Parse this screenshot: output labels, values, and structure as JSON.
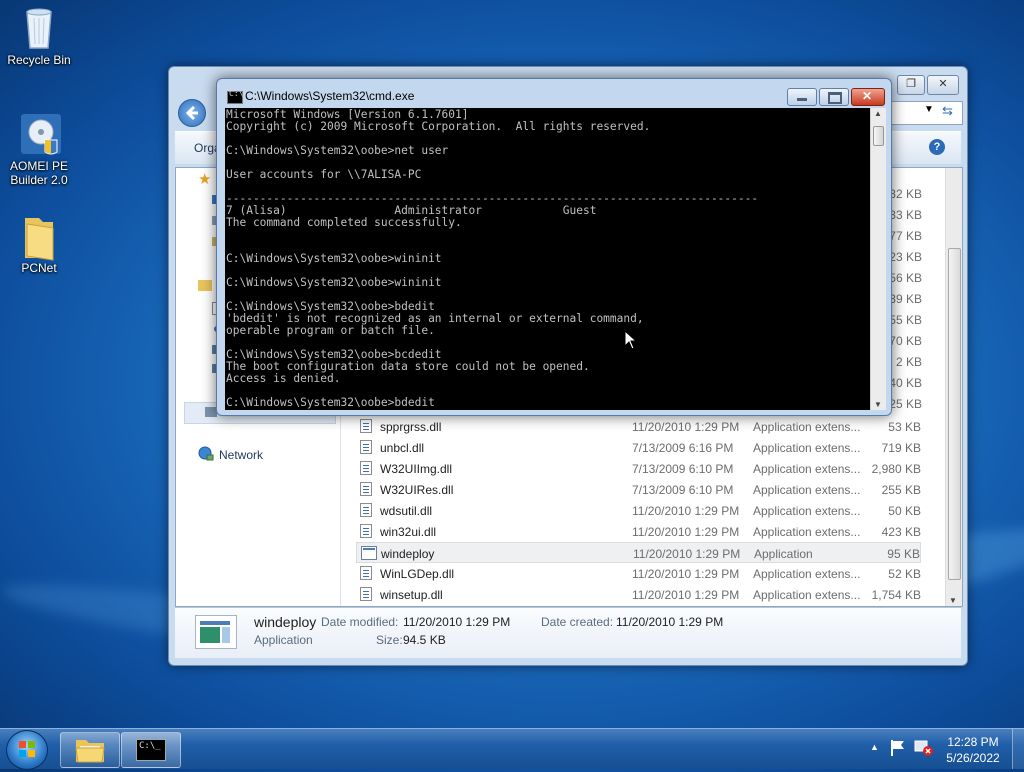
{
  "desktop": {
    "icons": [
      {
        "label": "Recycle Bin",
        "icon": "recycle-bin-icon"
      },
      {
        "label": "AOMEI PE Builder 2.0",
        "icon": "aomei-pe-builder-icon"
      },
      {
        "label": "PCNet",
        "icon": "folder-icon"
      }
    ]
  },
  "explorer": {
    "toolbar_organize": "Orga",
    "nav_network": "Network",
    "files": [
      {
        "name": "spprgrss.dll",
        "date": "11/20/2010 1:29 PM",
        "type": "Application extens...",
        "size": "53 KB"
      },
      {
        "name": "unbcl.dll",
        "date": "7/13/2009 6:16 PM",
        "type": "Application extens...",
        "size": "719 KB"
      },
      {
        "name": "W32UIImg.dll",
        "date": "7/13/2009 6:10 PM",
        "type": "Application extens...",
        "size": "2,980 KB"
      },
      {
        "name": "W32UIRes.dll",
        "date": "7/13/2009 6:10 PM",
        "type": "Application extens...",
        "size": "255 KB"
      },
      {
        "name": "wdsutil.dll",
        "date": "11/20/2010 1:29 PM",
        "type": "Application extens...",
        "size": "50 KB"
      },
      {
        "name": "win32ui.dll",
        "date": "11/20/2010 1:29 PM",
        "type": "Application extens...",
        "size": "423 KB"
      },
      {
        "name": "windeploy",
        "date": "11/20/2010 1:29 PM",
        "type": "Application",
        "size": "95 KB"
      },
      {
        "name": "WinLGDep.dll",
        "date": "11/20/2010 1:29 PM",
        "type": "Application extens...",
        "size": "52 KB"
      },
      {
        "name": "winsetup.dll",
        "date": "11/20/2010 1:29 PM",
        "type": "Application extens...",
        "size": "1,754 KB"
      }
    ],
    "hidden_sizes": [
      "32 KB",
      "33 KB",
      "77 KB",
      "23 KB",
      "56 KB",
      "39 KB",
      "55 KB",
      "70 KB",
      "2 KB",
      "40 KB",
      "25 KB"
    ],
    "details": {
      "name": "windeploy",
      "type": "Application",
      "modified_label": "Date modified:",
      "modified_value": "11/20/2010 1:29 PM",
      "created_label": "Date created:",
      "created_value": "11/20/2010 1:29 PM",
      "size_label": "Size:",
      "size_value": "94.5 KB"
    }
  },
  "cmd": {
    "title": "C:\\Windows\\System32\\cmd.exe",
    "output": "Microsoft Windows [Version 6.1.7601]\nCopyright (c) 2009 Microsoft Corporation.  All rights reserved.\n\nC:\\Windows\\System32\\oobe>net user\n\nUser accounts for \\\\7ALISA-PC\n\n-------------------------------------------------------------------------------\n7 (Alisa)                Administrator            Guest\nThe command completed successfully.\n\n\nC:\\Windows\\System32\\oobe>wininit\n\nC:\\Windows\\System32\\oobe>wininit\n\nC:\\Windows\\System32\\oobe>bdedit\n'bdedit' is not recognized as an internal or external command,\noperable program or batch file.\n\nC:\\Windows\\System32\\oobe>bcdedit\nThe boot configuration data store could not be opened.\nAccess is denied.\n\nC:\\Windows\\System32\\oobe>bdedit"
  },
  "taskbar": {
    "time": "12:28 PM",
    "date": "5/26/2022"
  },
  "colors": {
    "accent": "#1f5ea8",
    "console_bg": "#000000",
    "console_fg": "#c0c0c0"
  }
}
